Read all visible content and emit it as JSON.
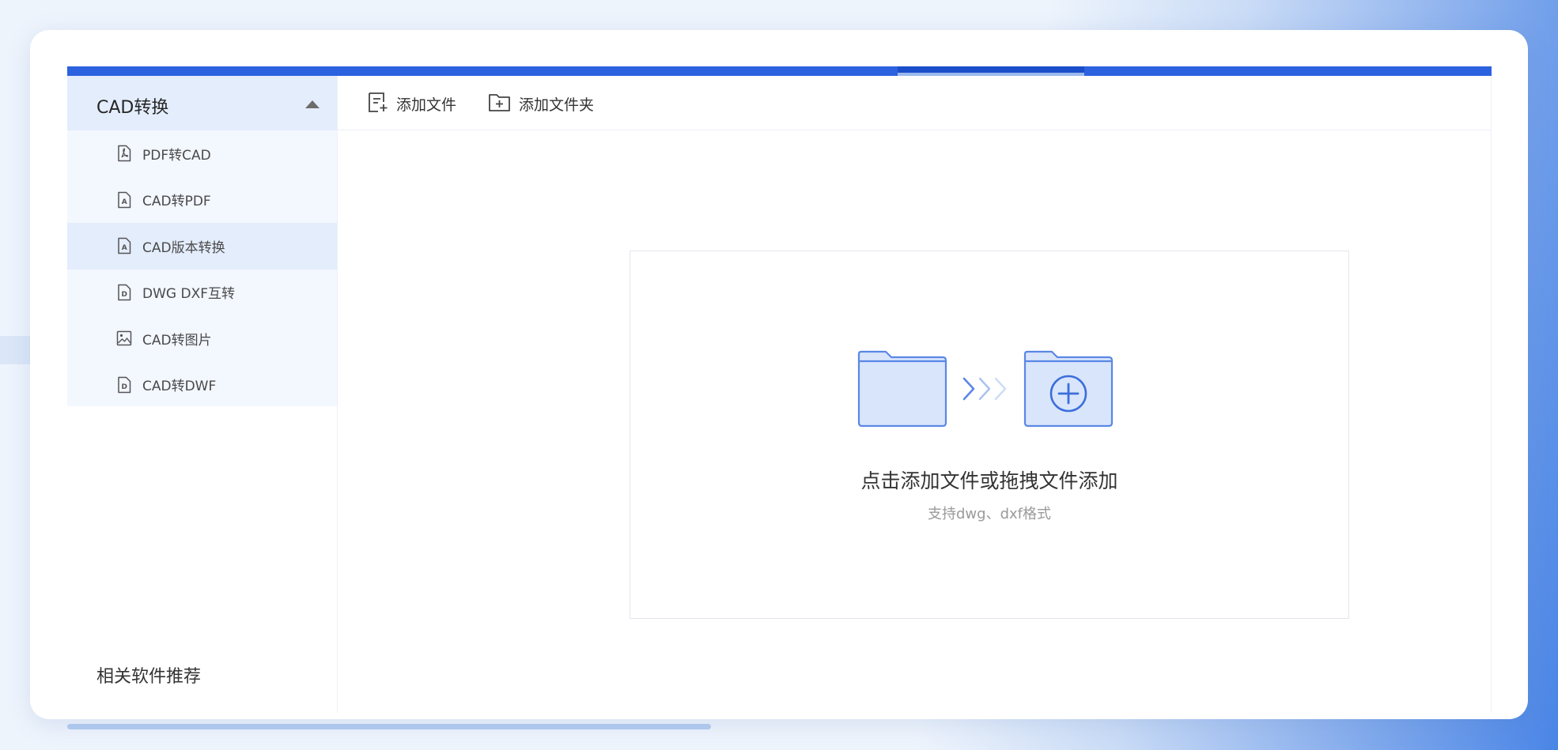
{
  "sidebar": {
    "title": "CAD转换",
    "items": [
      {
        "label": "PDF转CAD",
        "icon": "pdf-file-icon"
      },
      {
        "label": "CAD转PDF",
        "icon": "a-file-icon"
      },
      {
        "label": "CAD版本转换",
        "icon": "a-file-icon",
        "active": true
      },
      {
        "label": "DWG DXF互转",
        "icon": "d-file-icon"
      },
      {
        "label": "CAD转图片",
        "icon": "image-icon"
      },
      {
        "label": "CAD转DWF",
        "icon": "d-file-icon"
      }
    ],
    "related_title": "相关软件推荐"
  },
  "toolbar": {
    "add_file_label": "添加文件",
    "add_folder_label": "添加文件夹"
  },
  "dropzone": {
    "title": "点击添加文件或拖拽文件添加",
    "subtitle": "支持dwg、dxf格式"
  },
  "colors": {
    "accent": "#2c62e0",
    "sidebar_bg": "#f3f7fe",
    "sidebar_active": "#e4edfc",
    "folder_fill": "#d9e5fb",
    "folder_stroke": "#5b87e6"
  }
}
